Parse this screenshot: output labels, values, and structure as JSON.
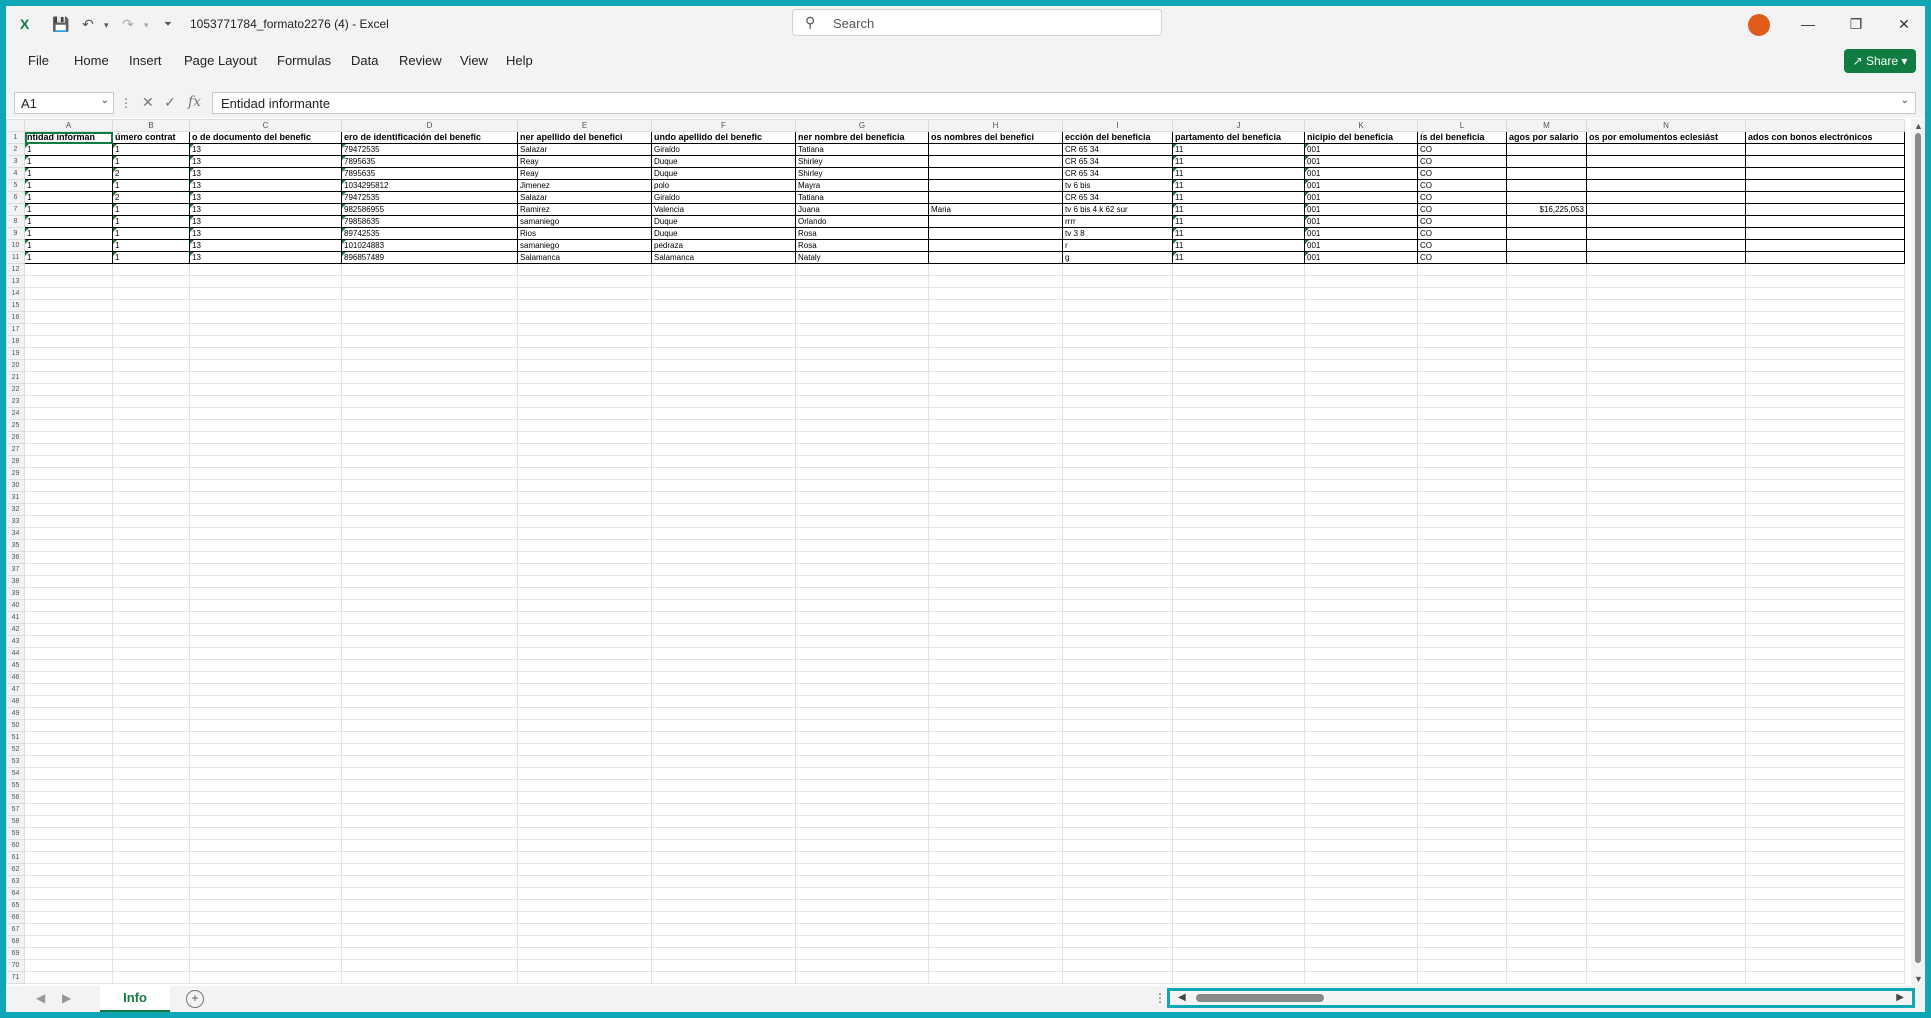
{
  "window": {
    "title": "1053771784_formato2276 (4)  -  Excel"
  },
  "search": {
    "placeholder": "Search"
  },
  "menu": [
    "File",
    "Home",
    "Insert",
    "Page Layout",
    "Formulas",
    "Data",
    "Review",
    "View",
    "Help"
  ],
  "share_label": "Share",
  "namebox": "A1",
  "formula": "Entidad informante",
  "columns": [
    "A",
    "B",
    "C",
    "D",
    "E",
    "F",
    "G",
    "H",
    "I",
    "J",
    "K",
    "L",
    "M",
    "N",
    ""
  ],
  "header_row": [
    "ntidad informan",
    "úmero contrat",
    "o de documento del benefic",
    "ero de identificación del benefic",
    "ner apellido del benefici",
    "undo apellido del benefic",
    "ner nombre del beneficia",
    "os nombres del benefici",
    "ección del beneficia",
    "partamento del beneficia",
    "nicipio del beneficia",
    "ís del beneficia",
    "agos por salario",
    "os por emolumentos eclesiást",
    "ados con bonos electrónicos"
  ],
  "rows": [
    [
      "1",
      "1",
      "13",
      "79472535",
      "Salazar",
      "Giraldo",
      "Tatiana",
      "",
      "CR 65 34",
      "11",
      "001",
      "CO",
      "",
      "",
      ""
    ],
    [
      "1",
      "1",
      "13",
      "7895635",
      "Reay",
      "Duque",
      "Shirley",
      "",
      "CR 65 34",
      "11",
      "001",
      "CO",
      "",
      "",
      ""
    ],
    [
      "1",
      "2",
      "13",
      "7895635",
      "Reay",
      "Duque",
      "Shirley",
      "",
      "CR 65 34",
      "11",
      "001",
      "CO",
      "",
      "",
      ""
    ],
    [
      "1",
      "1",
      "13",
      "1034295812",
      "Jimenez",
      "polo",
      "Mayra",
      "",
      "tv 6 bis",
      "11",
      "001",
      "CO",
      "",
      "",
      ""
    ],
    [
      "1",
      "2",
      "13",
      "79472535",
      "Salazar",
      "Giraldo",
      "Tatiana",
      "",
      "CR 65 34",
      "11",
      "001",
      "CO",
      "",
      "",
      ""
    ],
    [
      "1",
      "1",
      "13",
      "982586955",
      "Ramirez",
      "Valencia",
      "Juana",
      "Maria",
      "tv 6 bis 4 k 62 sur",
      "11",
      "001",
      "CO",
      "$16,225,053",
      "",
      ""
    ],
    [
      "1",
      "1",
      "13",
      "79858635",
      "samaniego",
      "Duque",
      "Orlando",
      "",
      "rrrr",
      "11",
      "001",
      "CO",
      "",
      "",
      ""
    ],
    [
      "1",
      "1",
      "13",
      "89742535",
      "Rios",
      "Duque",
      "Rosa",
      "",
      "tv 3 8",
      "11",
      "001",
      "CO",
      "",
      "",
      ""
    ],
    [
      "1",
      "1",
      "13",
      "101024883",
      "samaniego",
      "pedraza",
      "Rosa",
      "",
      "r",
      "11",
      "001",
      "CO",
      "",
      "",
      ""
    ],
    [
      "1",
      "1",
      "13",
      "896857489",
      "Salamanca",
      "Salamanca",
      "Nataly",
      "",
      "g",
      "11",
      "001",
      "CO",
      "",
      "",
      ""
    ]
  ],
  "empty_row_count": 60,
  "sheet_tab": "Info"
}
